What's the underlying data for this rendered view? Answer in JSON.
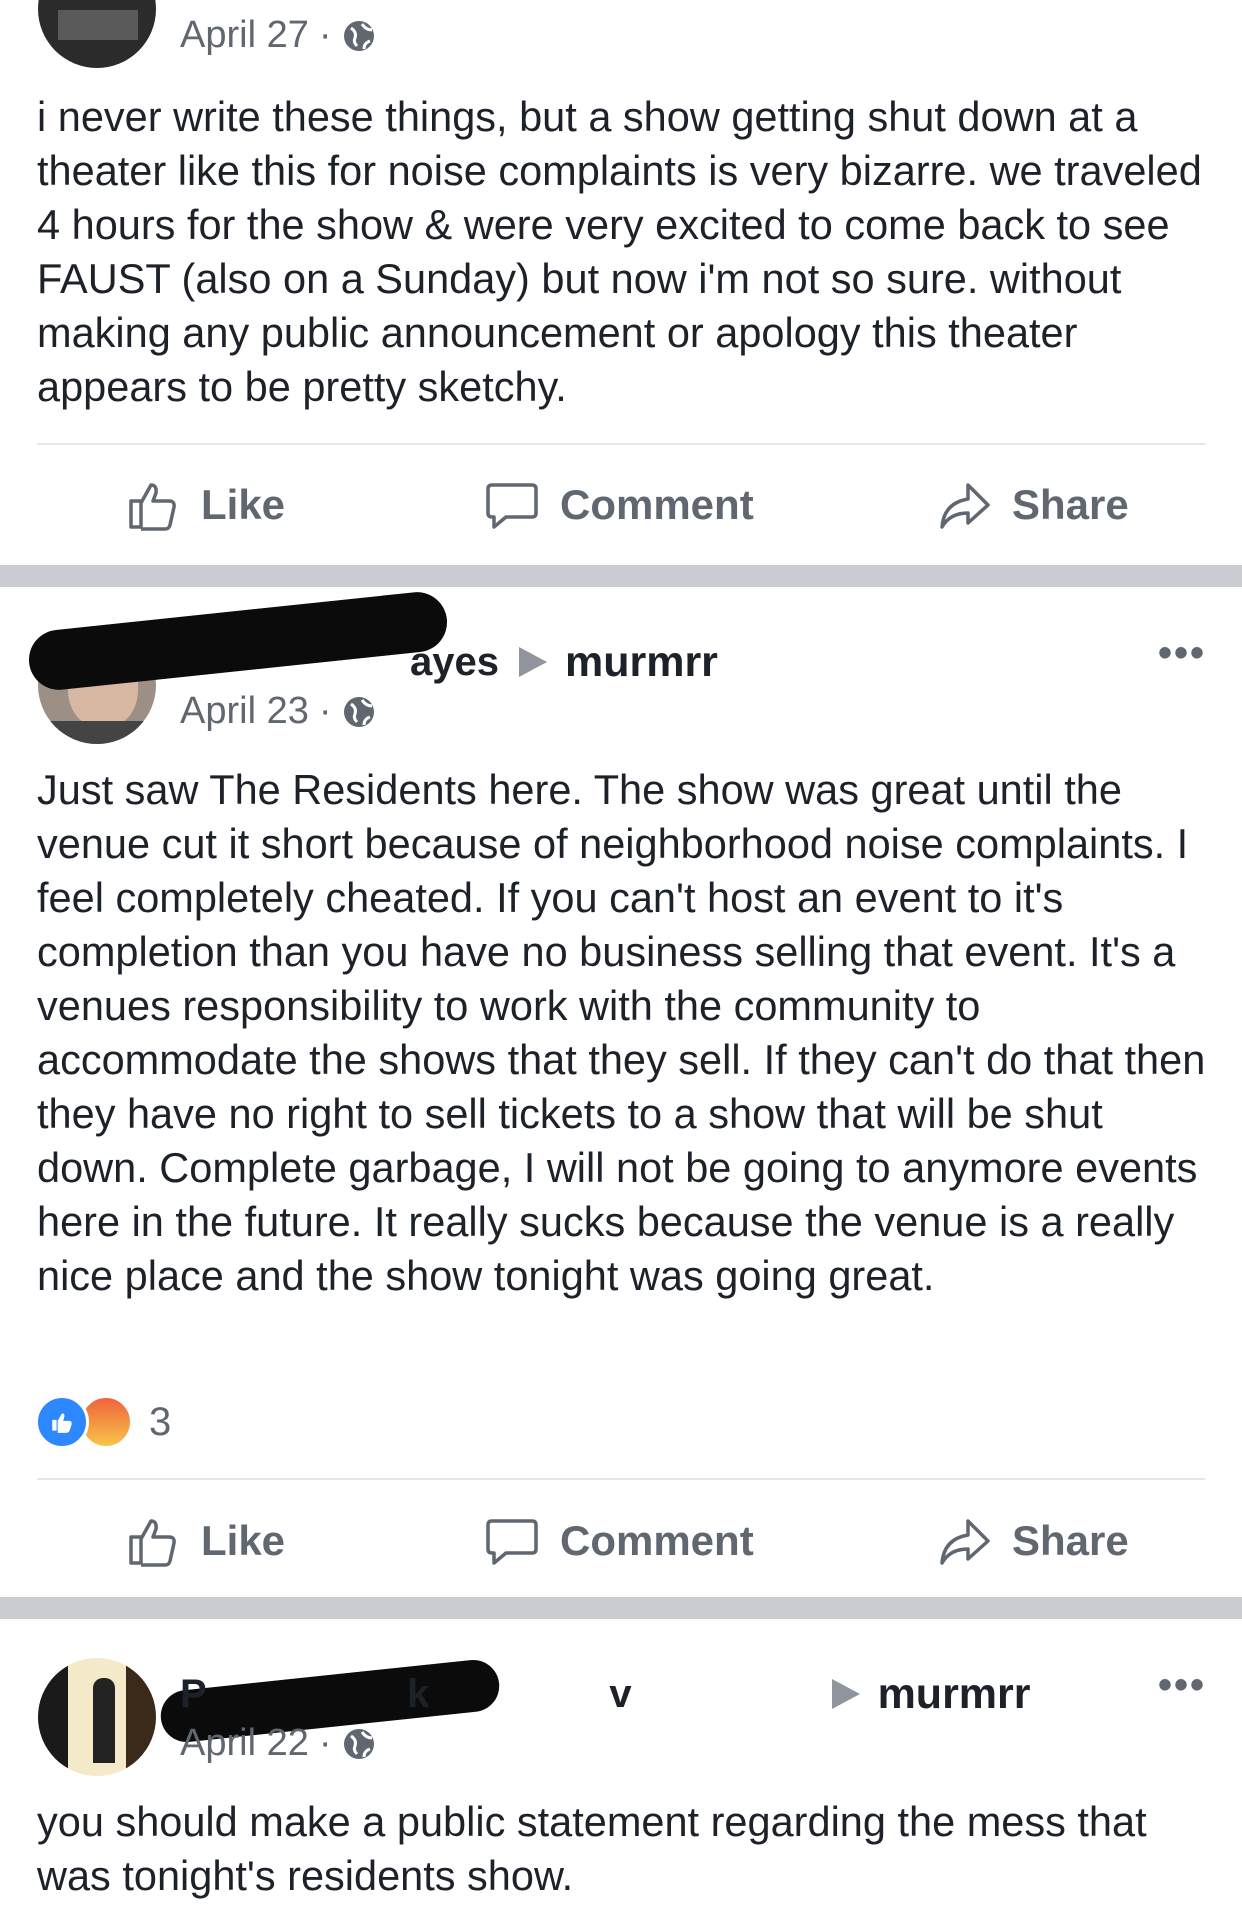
{
  "colors": {
    "brand": "#4267b2",
    "separator": "#c9ccd1",
    "muted": "#606770",
    "text": "#1d2129",
    "like_blue": "#2d88ff"
  },
  "icons": {
    "globe": "globe-icon",
    "like": "thumbs-up-icon",
    "comment": "speech-bubble-icon",
    "share": "share-arrow-icon",
    "more": "more-dots-icon"
  },
  "actions": {
    "like": "Like",
    "comment": "Comment",
    "share": "Share"
  },
  "posts": [
    {
      "date": "April 27",
      "dot": "·",
      "body": "i never write these things, but a show getting shut down at a theater like this for noise complaints is very bizarre. we traveled 4 hours for the show & were very excited to come back to see FAUST (also on a Sunday) but now i'm not so sure. without making any public announcement or apology this theater appears to be pretty sketchy."
    },
    {
      "author_visible": "ayes",
      "target": "murmrr",
      "date": "April 23",
      "dot": "·",
      "more": "•••",
      "body": "Just saw The Residents here. The show was great until the venue cut it short because of neighborhood noise complaints. I feel completely cheated. If you can't host an event to it's completion than you have no business selling that event. It's a venues responsibility to work with the community to accommodate the shows that they sell. If they can't do that then they have no right to sell tickets to a show that will be shut down. Complete garbage, I will not be going to anymore events here in the future. It really sucks because the venue is a really nice place and the show tonight was going great.",
      "reaction_count": "3"
    },
    {
      "author_visible": "P kv",
      "target": "murmrr",
      "date": "April 22",
      "dot": "·",
      "more": "•••",
      "body": "you should make a public statement regarding the mess that was tonight's residents show."
    }
  ]
}
